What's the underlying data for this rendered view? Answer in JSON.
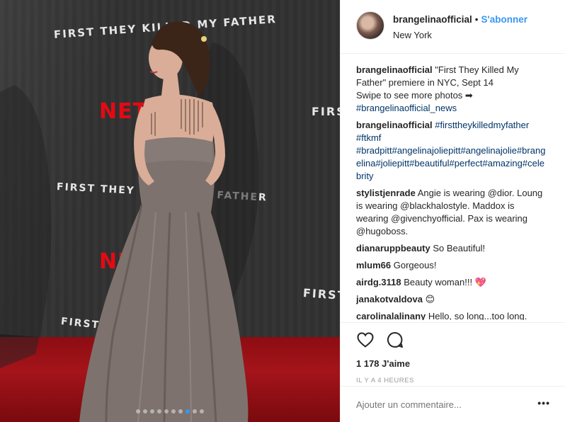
{
  "photo": {
    "wall_texts": [
      "FIRST THEY KILLED MY FATHER",
      "FIRST THEY KILLED MY FATHER",
      "FIRST",
      "FIRST",
      "FIRST TH"
    ],
    "brand": [
      "NETFLIX",
      "NETFLIX"
    ],
    "carousel": {
      "count": 10,
      "active_index": 7
    },
    "accent": "#3897f0"
  },
  "header": {
    "username": "brangelinaofficial",
    "separator": "•",
    "follow_label": "S'abonner",
    "location": "New York"
  },
  "caption": {
    "user": "brangelinaofficial",
    "text": "\"First They Killed My Father\" premiere in NYC, Sept 14",
    "swipe": "Swipe to see more photos ➡",
    "tag": "#brangelinaofficial_news"
  },
  "comments": [
    {
      "user": "brangelinaofficial",
      "text": "#firsttheykilledmyfather #ftkmf #bradpitt#angelinajoliepitt#angelinajolie#brangelina#joliepitt#beautiful#perfect#amazing#celebrity"
    },
    {
      "user": "stylistjenrade",
      "text": "Angie is wearing @dior. Loung is wearing @blackhalostyle. Maddox is wearing @givenchyofficial. Pax is wearing @hugoboss."
    },
    {
      "user": "dianaruppbeauty",
      "text": "So Beautiful!"
    },
    {
      "user": "mlum66",
      "text": "Gorgeous!"
    },
    {
      "user": "airdg.3118",
      "text": "Beauty woman!!! 💖"
    },
    {
      "user": "janakotvaldova",
      "text": "😊"
    },
    {
      "user": "carolinalalinany",
      "text": "Hello, so long...too long."
    }
  ],
  "actions": {
    "like_icon": "heart-icon",
    "comment_icon": "comment-bubble-icon",
    "likes": "1 178 J'aime",
    "time": "IL Y A 4 HEURES"
  },
  "add_comment": {
    "placeholder": "Ajouter un commentaire...",
    "more": "•••"
  }
}
